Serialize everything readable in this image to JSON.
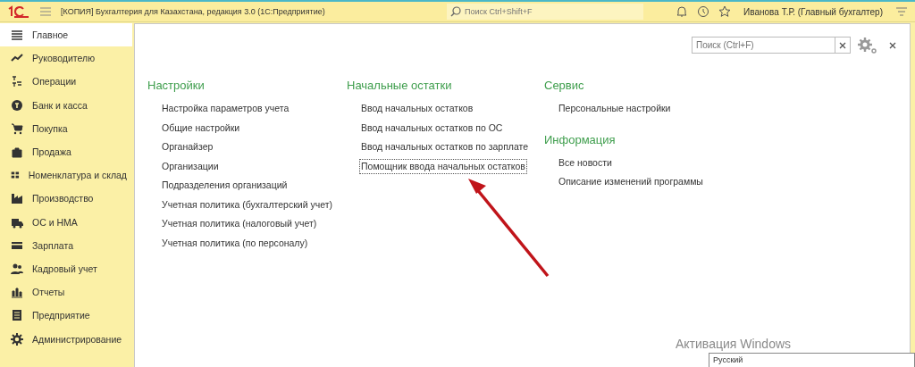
{
  "header": {
    "title": "[КОПИЯ] Бухгалтерия для Казахстана, редакция 3.0  (1С:Предприятие)",
    "search": {
      "placeholder": "Поиск Ctrl+Shift+F"
    },
    "user": "Иванова Т.Р. (Главный бухгалтер)"
  },
  "sidebar": {
    "items": [
      {
        "label": "Главное",
        "selected": true
      },
      {
        "label": "Руководителю",
        "selected": false
      },
      {
        "label": "Операции",
        "selected": false
      },
      {
        "label": "Банк и касса",
        "selected": false
      },
      {
        "label": "Покупка",
        "selected": false
      },
      {
        "label": "Продажа",
        "selected": false
      },
      {
        "label": "Номенклатура и склад",
        "selected": false
      },
      {
        "label": "Производство",
        "selected": false
      },
      {
        "label": "ОС и НМА",
        "selected": false
      },
      {
        "label": "Зарплата",
        "selected": false
      },
      {
        "label": "Кадровый учет",
        "selected": false
      },
      {
        "label": "Отчеты",
        "selected": false
      },
      {
        "label": "Предприятие",
        "selected": false
      },
      {
        "label": "Администрирование",
        "selected": false
      }
    ]
  },
  "panel": {
    "search": {
      "placeholder": "Поиск (Ctrl+F)"
    },
    "columns": [
      {
        "groups": [
          {
            "title": "Настройки",
            "links": [
              {
                "label": "Настройка параметров учета",
                "focused": false
              },
              {
                "label": "Общие настройки",
                "focused": false
              },
              {
                "label": "Органайзер",
                "focused": false
              },
              {
                "label": "Организации",
                "focused": false
              },
              {
                "label": "Подразделения организаций",
                "focused": false
              },
              {
                "label": "Учетная политика (бухгалтерский учет)",
                "focused": false
              },
              {
                "label": "Учетная политика (налоговый учет)",
                "focused": false
              },
              {
                "label": "Учетная политика (по персоналу)",
                "focused": false
              }
            ]
          }
        ]
      },
      {
        "groups": [
          {
            "title": "Начальные остатки",
            "links": [
              {
                "label": "Ввод начальных остатков",
                "focused": false
              },
              {
                "label": "Ввод начальных остатков по ОС",
                "focused": false
              },
              {
                "label": "Ввод начальных остатков по зарплате",
                "focused": false
              },
              {
                "label": "Помощник ввода начальных остатков",
                "focused": true
              }
            ]
          }
        ]
      },
      {
        "groups": [
          {
            "title": "Сервис",
            "links": [
              {
                "label": "Персональные настройки",
                "focused": false
              }
            ]
          },
          {
            "title": "Информация",
            "links": [
              {
                "label": "Все новости",
                "focused": false
              },
              {
                "label": "Описание изменений программы",
                "focused": false
              }
            ]
          }
        ]
      }
    ]
  },
  "windows_activation": "Активация Windows",
  "language_tooltip": "Русский"
}
